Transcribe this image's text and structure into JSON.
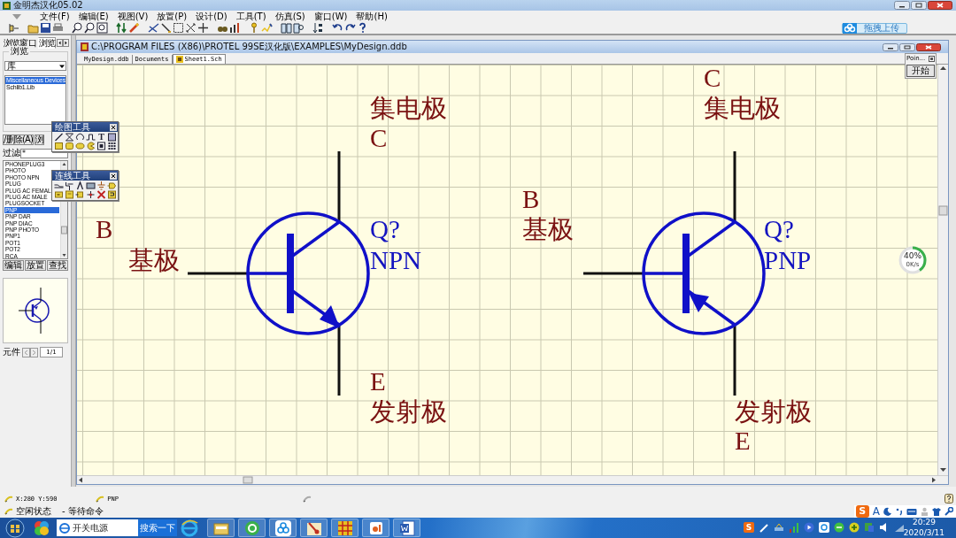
{
  "window": {
    "title": "金明杰汉化05.02"
  },
  "menu": [
    "文件(F)",
    "编辑(E)",
    "视图(V)",
    "放置(P)",
    "设计(D)",
    "工具(T)",
    "仿真(S)",
    "窗口(W)",
    "帮助(H)"
  ],
  "upload_button": "拖拽上传",
  "browser_panel": {
    "tabs": [
      {
        "label": "浏览窗口",
        "selected": false
      },
      {
        "label": "浏览",
        "selected": true
      }
    ],
    "group_title": "浏览",
    "browse_type": "库",
    "libraries": [
      {
        "name": "Miscellaneous Devices",
        "selected": true
      },
      {
        "name": "Schlib1.Lib",
        "selected": false
      }
    ],
    "library_buttons": [
      "/删除(A)",
      "浏"
    ],
    "filter": {
      "label": "过滤",
      "value": "*"
    },
    "components": [
      {
        "name": "PHONEPLUG3",
        "selected": false
      },
      {
        "name": "PHOTO",
        "selected": false
      },
      {
        "name": "PHOTO NPN",
        "selected": false
      },
      {
        "name": "PLUG",
        "selected": false
      },
      {
        "name": "PLUG AC FEMAL",
        "selected": false
      },
      {
        "name": "PLUG AC MALE",
        "selected": false
      },
      {
        "name": "PLUGSOCKET",
        "selected": false
      },
      {
        "name": "PNP",
        "selected": true
      },
      {
        "name": "PNP DAR",
        "selected": false
      },
      {
        "name": "PNP DIAC",
        "selected": false
      },
      {
        "name": "PNP PHOTO",
        "selected": false
      },
      {
        "name": "PNP1",
        "selected": false
      },
      {
        "name": "POT1",
        "selected": false
      },
      {
        "name": "POT2",
        "selected": false
      },
      {
        "name": "RCA",
        "selected": false
      }
    ],
    "component_buttons": [
      "编辑",
      "放置",
      "查找"
    ],
    "part_label": "元件",
    "part_counter": "1/1"
  },
  "floating_toolbars": [
    {
      "title": "绘图工具",
      "tools": [
        {
          "kind": "line"
        },
        {
          "kind": "polygon"
        },
        {
          "kind": "arc"
        },
        {
          "kind": "wave"
        },
        {
          "kind": "text",
          "glyph": "T"
        },
        {
          "kind": "frame"
        },
        {
          "kind": "rectangle"
        },
        {
          "kind": "rounded_rectangle"
        },
        {
          "kind": "ellipse"
        },
        {
          "kind": "pie"
        },
        {
          "kind": "image"
        },
        {
          "kind": "array"
        }
      ]
    },
    {
      "title": "连线工具",
      "tools": [
        {
          "kind": "wire"
        },
        {
          "kind": "bus"
        },
        {
          "kind": "bus_entry"
        },
        {
          "kind": "net_label"
        },
        {
          "kind": "ground"
        },
        {
          "kind": "port"
        },
        {
          "kind": "part"
        },
        {
          "kind": "sheet"
        },
        {
          "kind": "sheet_entry"
        },
        {
          "kind": "junction"
        },
        {
          "kind": "no_erc"
        },
        {
          "kind": "flag"
        }
      ]
    }
  ],
  "document": {
    "path": "C:\\PROGRAM FILES (X86)\\PROTEL 99SE汉化版\\EXAMPLES\\MyDesign.ddb",
    "tabs": [
      {
        "label": "MyDesign.ddb",
        "selected": false
      },
      {
        "label": "Documents",
        "selected": false
      },
      {
        "label": "Sheet1.Sch",
        "selected": true
      }
    ],
    "transistors": [
      {
        "kind": "npn",
        "designator": "Q?",
        "part": "NPN",
        "collector": {
          "pin": "C",
          "name": "集电极"
        },
        "base": {
          "pin": "B",
          "name": "基极"
        },
        "emitter": {
          "pin": "E",
          "name": "发射极"
        }
      },
      {
        "kind": "pnp",
        "designator": "Q?",
        "part": "PNP",
        "collector": {
          "pin": "C",
          "name": "集电极"
        },
        "base": {
          "pin": "B",
          "name": "基极"
        },
        "emitter": {
          "pin": "E",
          "name": "发射极"
        }
      }
    ]
  },
  "points_panel": {
    "title": "Poin...",
    "button": "开始"
  },
  "network_meter": {
    "percent": "40%",
    "speed": "0K/s",
    "level": 0.4
  },
  "status_bar": {
    "coordinates": "X:280 Y:590",
    "component": "PNP",
    "state": "空闲状态",
    "message": "- 等待命令"
  },
  "ime_toolbar": {
    "logo": "S",
    "letter": "A"
  },
  "taskbar": {
    "search_value": "开关电源",
    "search_button": "搜索一下",
    "tray_logo": "S",
    "time": "20:29",
    "date": "2020/3/11"
  }
}
